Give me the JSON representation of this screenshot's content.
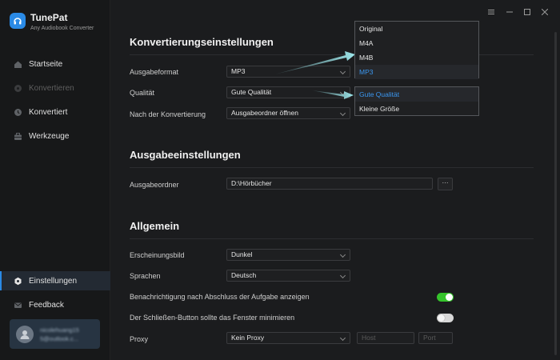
{
  "app": {
    "name": "TunePat",
    "subtitle": "Any Audiobook Converter"
  },
  "sidebar": {
    "items": [
      {
        "label": "Startseite",
        "icon": "home-icon",
        "state": "normal"
      },
      {
        "label": "Konvertieren",
        "icon": "convert-icon",
        "state": "disabled"
      },
      {
        "label": "Konvertiert",
        "icon": "clock-icon",
        "state": "normal"
      },
      {
        "label": "Werkzeuge",
        "icon": "toolbox-icon",
        "state": "normal"
      },
      {
        "label": "Einstellungen",
        "icon": "settings-icon",
        "state": "active"
      },
      {
        "label": "Feedback",
        "icon": "mail-icon",
        "state": "normal"
      }
    ],
    "user": {
      "line1": "nicolehuang15",
      "line2": "5@outlook.c..."
    }
  },
  "window_controls": [
    "menu-icon",
    "minimize-icon",
    "maximize-icon",
    "close-icon"
  ],
  "conversion": {
    "title": "Konvertierungseinstellungen",
    "output_format": {
      "label": "Ausgabeformat",
      "value": "MP3"
    },
    "quality": {
      "label": "Qualität",
      "value": "Gute Qualität"
    },
    "after_conversion": {
      "label": "Nach der Konvertierung",
      "value": "Ausgabeordner öffnen"
    }
  },
  "output": {
    "title": "Ausgabeeinstellungen",
    "folder": {
      "label": "Ausgabeordner",
      "value": "D:\\Hörbücher",
      "browse_label": "···"
    }
  },
  "general": {
    "title": "Allgemein",
    "appearance": {
      "label": "Erscheinungsbild",
      "value": "Dunkel"
    },
    "language": {
      "label": "Sprachen",
      "value": "Deutsch"
    },
    "notify": {
      "label": "Benachrichtigung nach Abschluss der Aufgabe anzeigen",
      "enabled": true
    },
    "close_minimize": {
      "label": "Der Schließen-Button sollte das Fenster minimieren",
      "enabled": false
    },
    "proxy": {
      "label": "Proxy",
      "value": "Kein Proxy",
      "host_placeholder": "Host",
      "port_placeholder": "Port"
    }
  },
  "format_dropdown": {
    "options": [
      "Original",
      "M4A",
      "M4B",
      "MP3"
    ],
    "selected": "MP3"
  },
  "quality_dropdown": {
    "options": [
      "Gute Qualität",
      "Kleine Größe"
    ],
    "selected": "Gute Qualität"
  },
  "colors": {
    "accent": "#2a8ae6",
    "toggle_on": "#35c42b",
    "arrow": "#9ee8ec",
    "background": "#1b1c1e"
  }
}
